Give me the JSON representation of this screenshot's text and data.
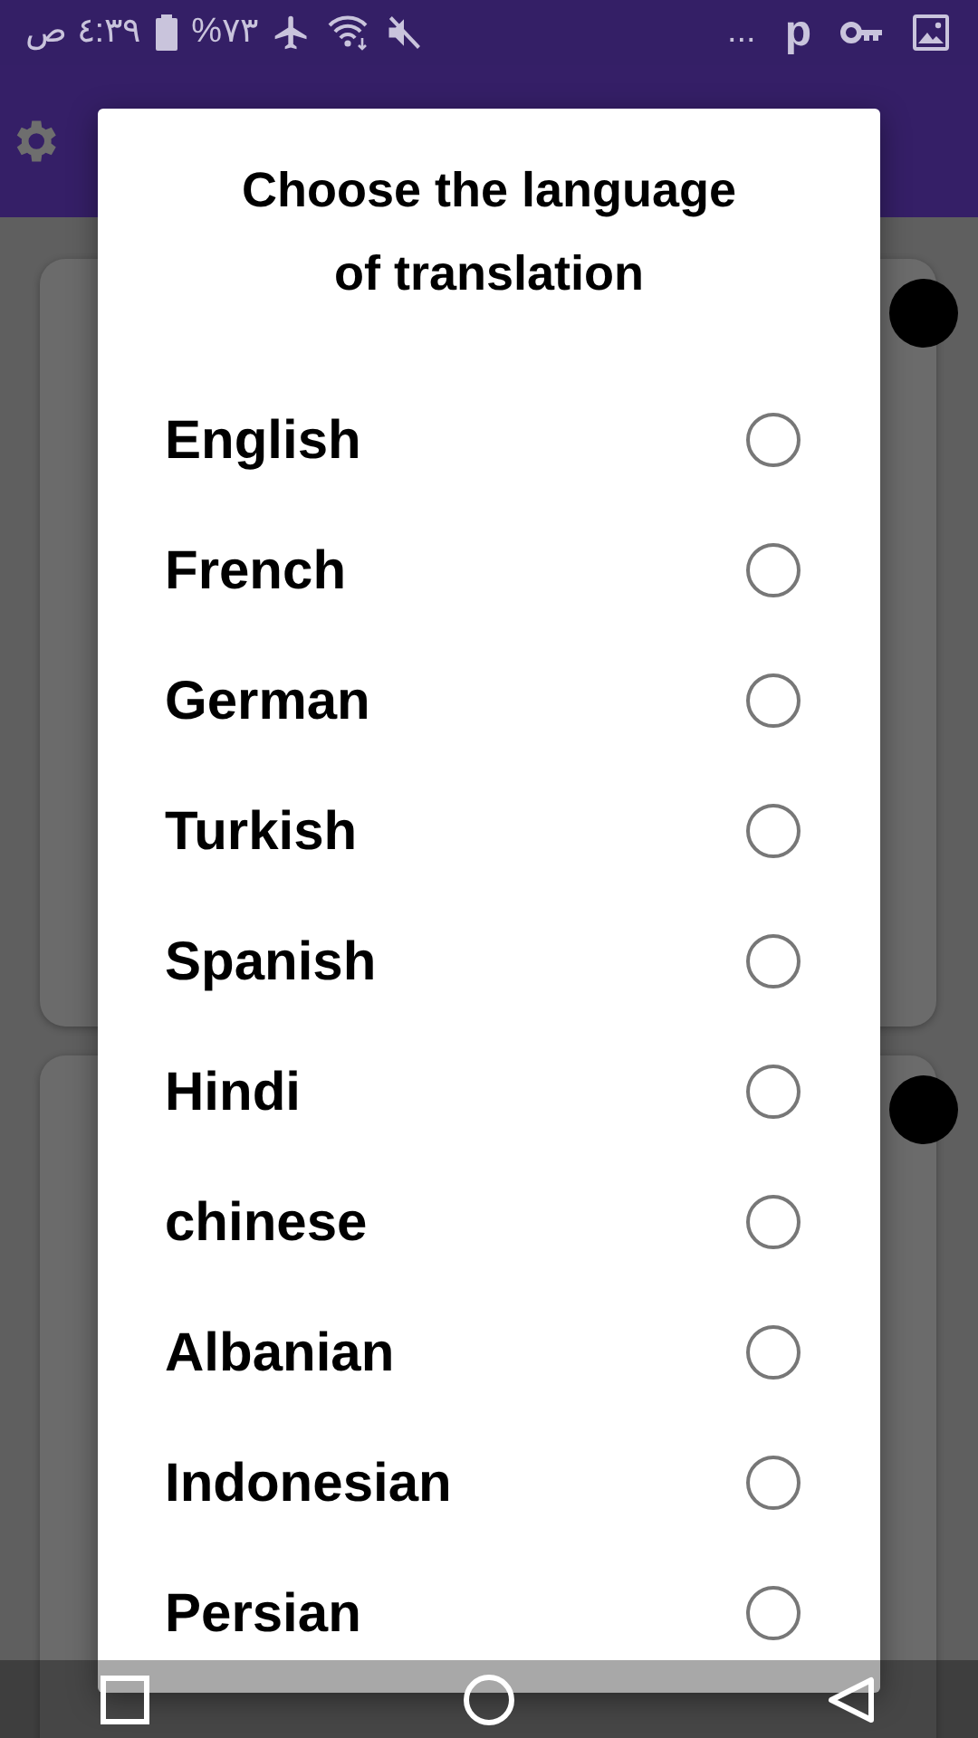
{
  "status_bar": {
    "time": "٤:٣٩ ص",
    "battery": "٧٣%",
    "more_notifications": "...",
    "p_notification": "p"
  },
  "dialog": {
    "title": "Choose the language of translation",
    "options": [
      {
        "label": "English",
        "selected": false
      },
      {
        "label": "French",
        "selected": false
      },
      {
        "label": "German",
        "selected": false
      },
      {
        "label": "Turkish",
        "selected": false
      },
      {
        "label": "Spanish",
        "selected": false
      },
      {
        "label": "Hindi",
        "selected": false
      },
      {
        "label": "chinese",
        "selected": false
      },
      {
        "label": "Albanian",
        "selected": false
      },
      {
        "label": "Indonesian",
        "selected": false
      },
      {
        "label": "Persian",
        "selected": false
      }
    ]
  }
}
